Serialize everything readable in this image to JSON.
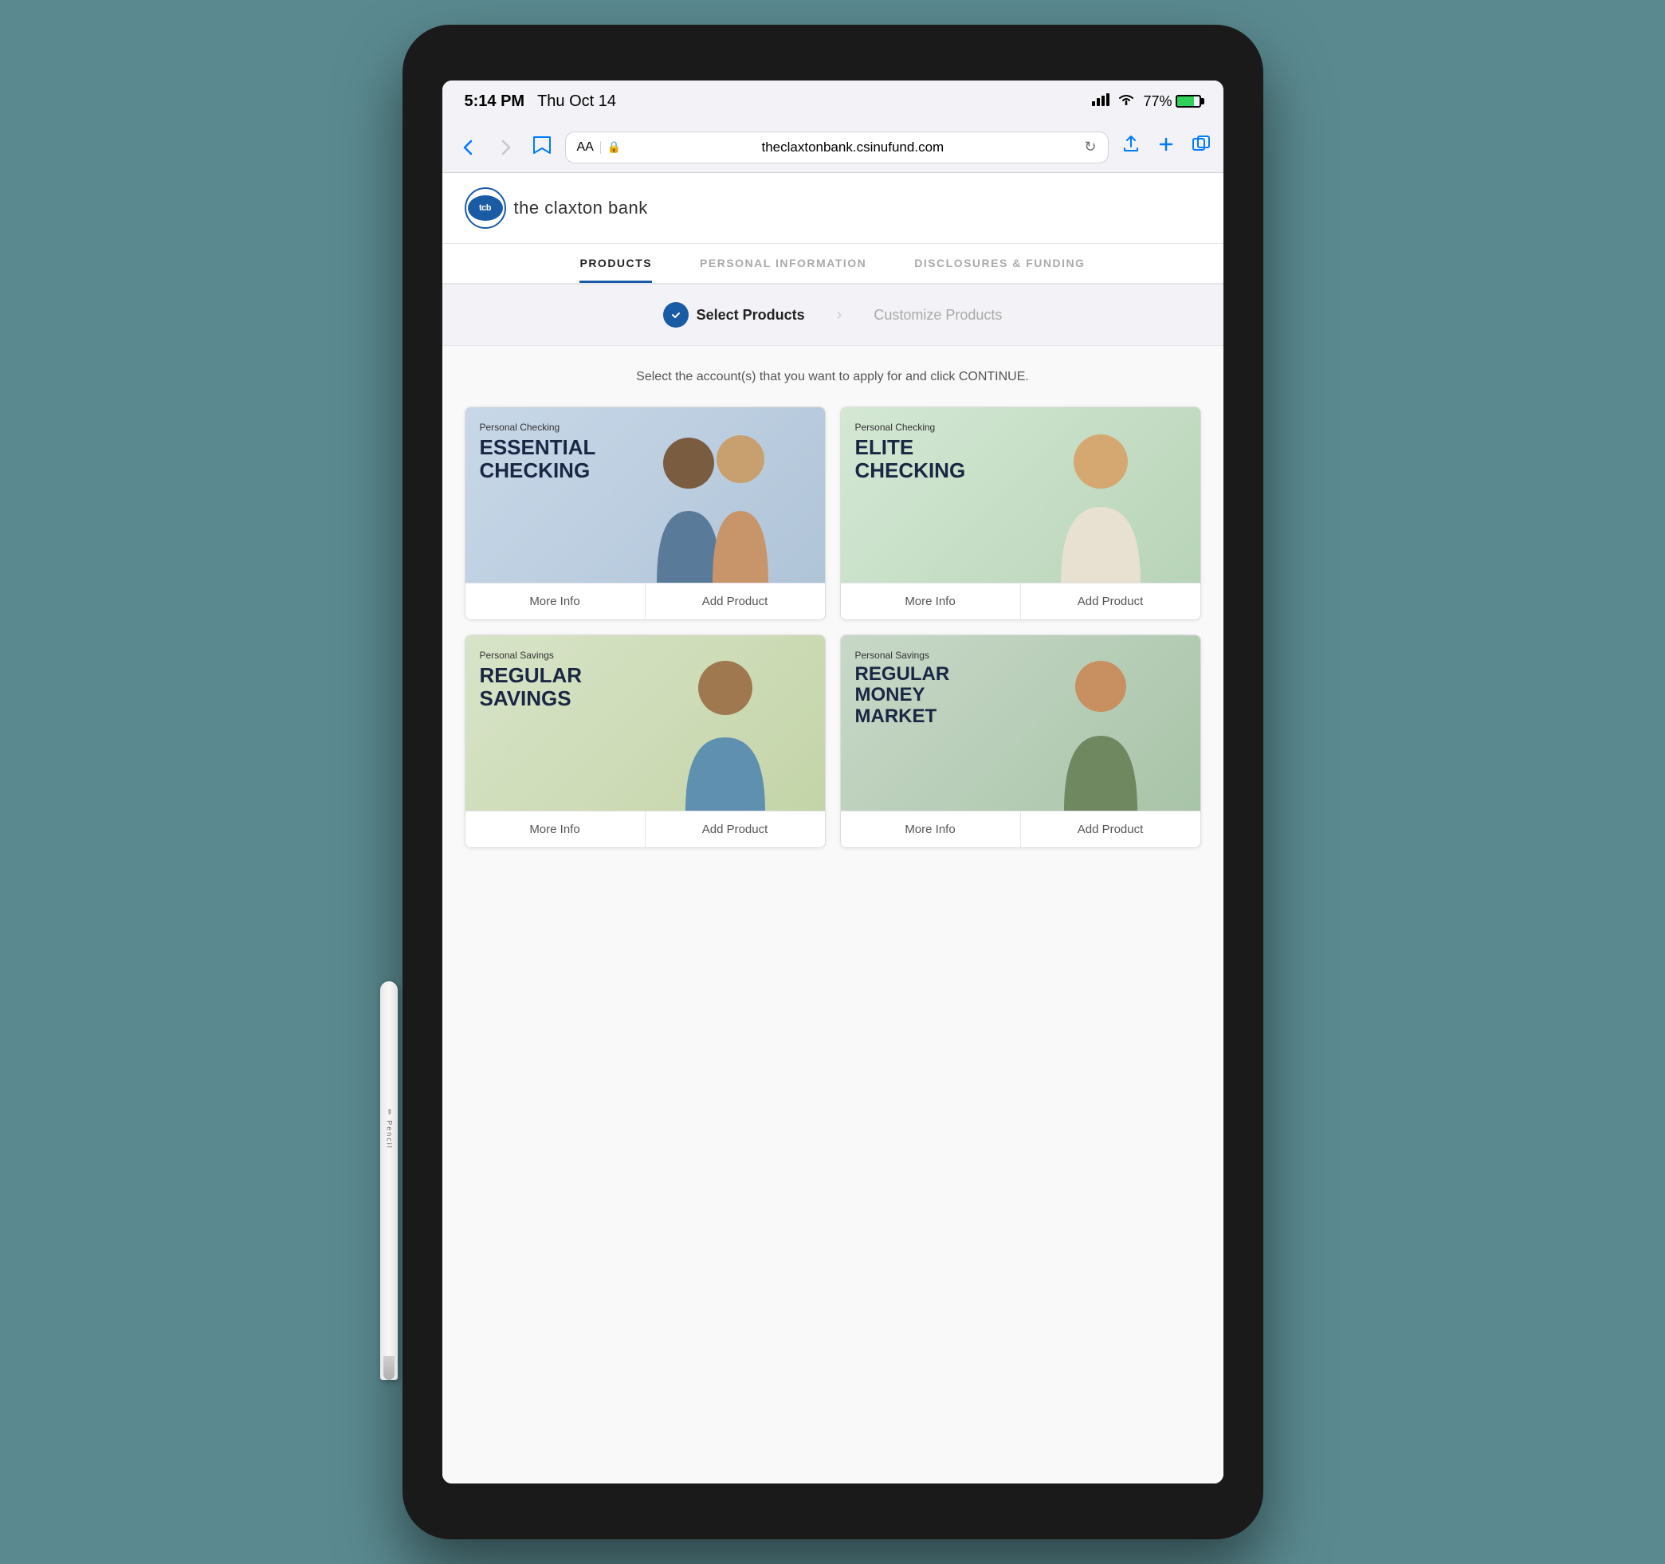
{
  "device": {
    "type": "iPad",
    "status_bar": {
      "time": "5:14 PM",
      "date": "Thu Oct 14",
      "signal": "▲▲▲",
      "wifi": "WiFi",
      "battery_pct": "77%"
    },
    "browser": {
      "url": "theclaxtonbank.csinufund.com",
      "aa_label": "AA"
    }
  },
  "bank": {
    "name": "the claxton bank",
    "badge": "tcb"
  },
  "steps": [
    {
      "label": "PRODUCTS",
      "active": true
    },
    {
      "label": "PERSONAL INFORMATION",
      "active": false
    },
    {
      "label": "DISCLOSURES & FUNDING",
      "active": false
    }
  ],
  "sub_steps": [
    {
      "label": "Select Products",
      "active": true,
      "icon": "→"
    },
    {
      "label": "Customize Products",
      "active": false
    }
  ],
  "instruction": "Select the account(s) that you want to apply for and click CONTINUE.",
  "products": [
    {
      "id": "essential-checking",
      "category": "Personal Checking",
      "title": "ESSENTIAL\nCHECKING",
      "more_info_label": "More Info",
      "add_product_label": "Add Product",
      "theme": "essential"
    },
    {
      "id": "elite-checking",
      "category": "Personal Checking",
      "title": "ELITE\nCHECKING",
      "more_info_label": "More Info",
      "add_product_label": "Add Product",
      "theme": "elite"
    },
    {
      "id": "regular-savings",
      "category": "Personal Savings",
      "title": "REGULAR\nSAVINGS",
      "more_info_label": "More Info",
      "add_product_label": "Add Product",
      "theme": "savings"
    },
    {
      "id": "money-market",
      "category": "Personal Savings",
      "title": "REGULAR\nMONEY\nMARKET",
      "more_info_label": "More Info",
      "add_product_label": "Add Product",
      "theme": "money-market"
    }
  ],
  "nav": {
    "back_label": "‹",
    "forward_label": "›",
    "reload_label": "↻",
    "share_label": "⬆",
    "add_label": "+",
    "tabs_label": "⧉"
  }
}
